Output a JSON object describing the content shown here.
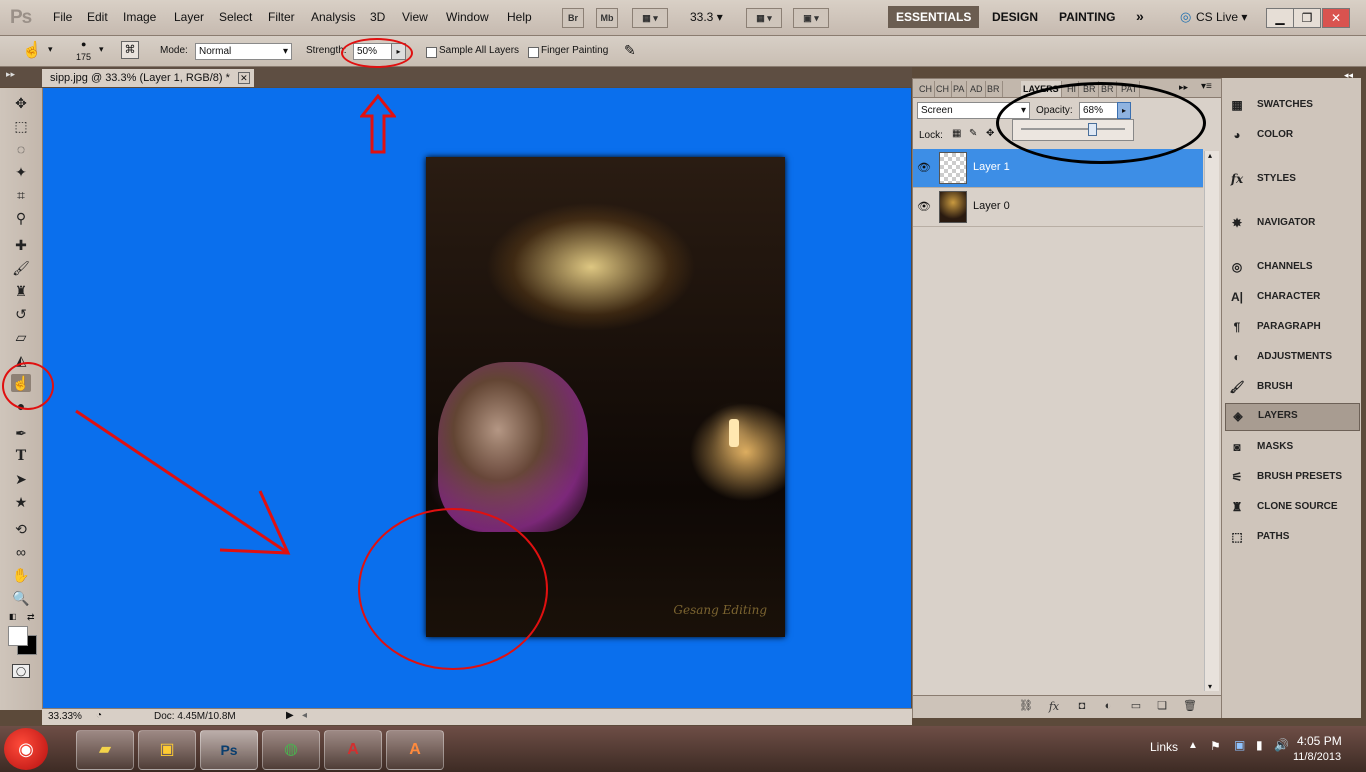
{
  "app": {
    "logo": "Ps"
  },
  "menu": [
    "File",
    "Edit",
    "Image",
    "Layer",
    "Select",
    "Filter",
    "Analysis",
    "3D",
    "View",
    "Window",
    "Help"
  ],
  "menubar_buttons": {
    "bridge": "Br",
    "minibridge": "Mb",
    "zoom": "33.3"
  },
  "workspaces": [
    "ESSENTIALS",
    "DESIGN",
    "PAINTING"
  ],
  "cslive": "CS Live",
  "options": {
    "brush_size": "175",
    "mode_label": "Mode:",
    "mode_value": "Normal",
    "strength_label": "Strength:",
    "strength_value": "50%",
    "sample_all_layers": "Sample All Layers",
    "finger_painting": "Finger Painting"
  },
  "document": {
    "tab_title": "sipp.jpg @ 33.3% (Layer 1, RGB/8) *",
    "signature": "Gesang Editing"
  },
  "status": {
    "zoom": "33.33%",
    "doc": "Doc: 4.45M/10.8M"
  },
  "layers_panel": {
    "tabs": [
      "CH",
      "CH",
      "PA",
      "AD",
      "BR",
      "LAYERS",
      "HI",
      "BR",
      "BR",
      "PAT"
    ],
    "blend_mode": "Screen",
    "opacity_label": "Opacity:",
    "opacity_value": "68%",
    "opacity_slider_fraction": 0.68,
    "lock_label": "Lock:",
    "layers": [
      {
        "name": "Layer 1",
        "selected": true
      },
      {
        "name": "Layer 0",
        "selected": false
      }
    ]
  },
  "dock": [
    "SWATCHES",
    "COLOR",
    "STYLES",
    "NAVIGATOR",
    "CHANNELS",
    "CHARACTER",
    "PARAGRAPH",
    "ADJUSTMENTS",
    "BRUSH",
    "LAYERS",
    "MASKS",
    "BRUSH PRESETS",
    "CLONE SOURCE",
    "PATHS"
  ],
  "dock_active": "LAYERS",
  "taskbar": {
    "links": "Links",
    "time": "4:05 PM",
    "date": "11/8/2013"
  },
  "colors": {
    "canvas": "#0a6fed",
    "accent": "#3d8ee6",
    "annotation_red": "#e01010"
  }
}
